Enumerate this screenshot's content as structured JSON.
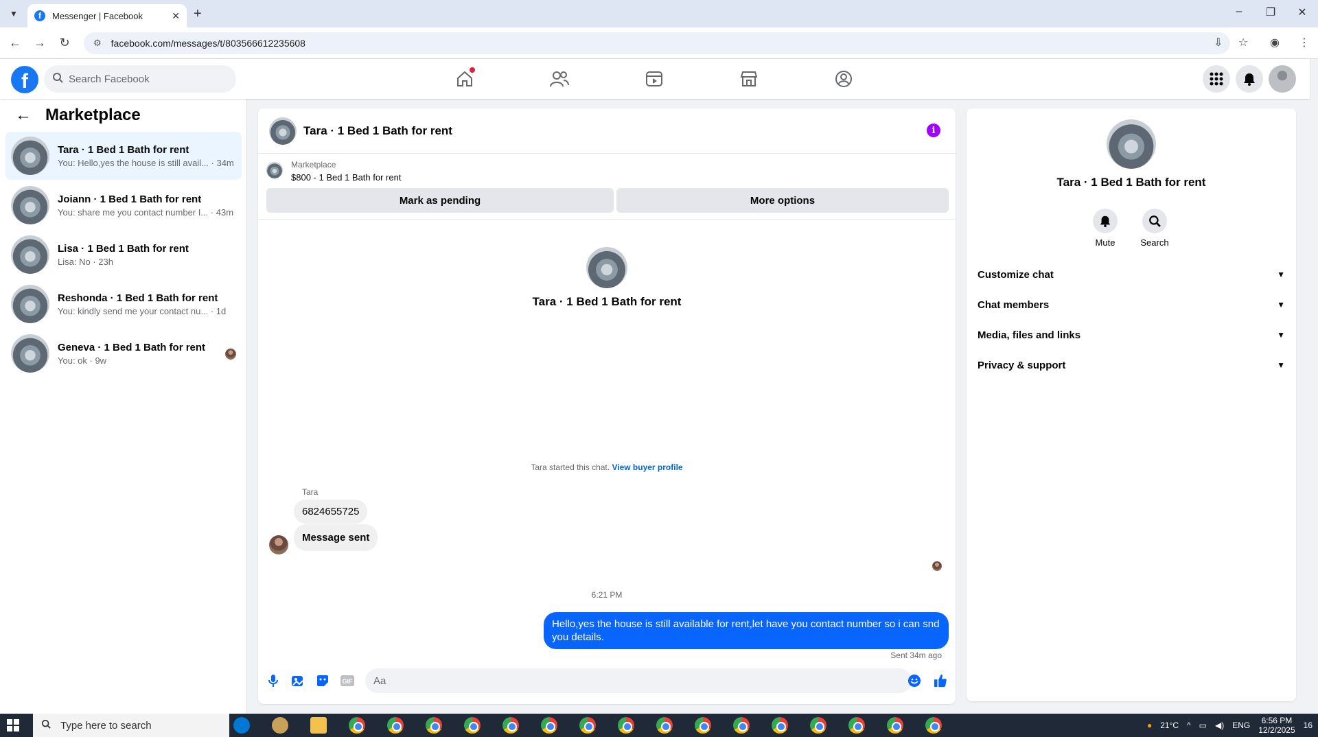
{
  "browser": {
    "tab_title": "Messenger | Facebook",
    "url": "facebook.com/messages/t/803566612235608"
  },
  "header": {
    "search_placeholder": "Search Facebook"
  },
  "sidebar": {
    "title": "Marketplace",
    "conversations": [
      {
        "name": "Tara · 1 Bed 1 Bath for rent",
        "snippet": "You: Hello,yes the house is still avail... · 34m",
        "active": true
      },
      {
        "name": "Joiann · 1 Bed 1 Bath for rent",
        "snippet": "You: share me you contact number I... · 43m"
      },
      {
        "name": "Lisa · 1 Bed 1 Bath for rent",
        "snippet": "Lisa: No · 23h"
      },
      {
        "name": "Reshonda · 1 Bed 1 Bath for rent",
        "snippet": "You: kindly send me your contact nu... · 1d"
      },
      {
        "name": "Geneva · 1 Bed 1 Bath for rent",
        "snippet": "You: ok · 9w"
      }
    ]
  },
  "chat": {
    "title": "Tara · 1 Bed 1 Bath for rent",
    "marketplace_label": "Marketplace",
    "item": "$800 - 1 Bed 1 Bath for rent",
    "btn_pending": "Mark as pending",
    "btn_more": "More options",
    "center_name": "Tara · 1 Bed 1 Bath for rent",
    "started_text": "Tara started this chat.",
    "view_profile": "View buyer profile",
    "sender": "Tara",
    "msg1": "6824655725",
    "msg2": "Message sent",
    "time": "6:21 PM",
    "outgoing": "Hello,yes the house is still available for rent,let have you contact number so i can snd you details.",
    "sent_status": "Sent 34m ago",
    "composer_placeholder": "Aa"
  },
  "details": {
    "name": "Tara · 1 Bed 1 Bath for rent",
    "mute": "Mute",
    "search": "Search",
    "rows": [
      "Customize chat",
      "Chat members",
      "Media, files and links",
      "Privacy & support"
    ]
  },
  "taskbar": {
    "search": "Type here to search",
    "temp": "21°C",
    "lang": "ENG",
    "time": "6:56 PM",
    "date": "12/2/2025",
    "notif_count": "16"
  }
}
